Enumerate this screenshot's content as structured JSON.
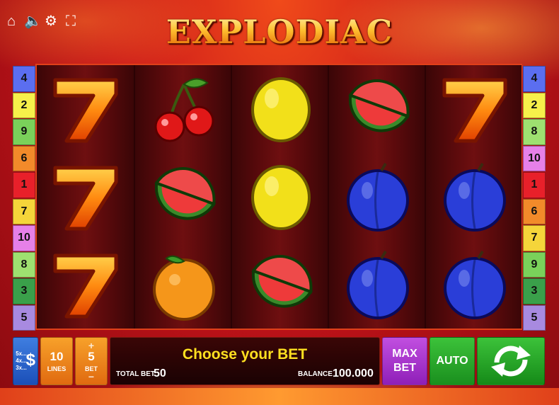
{
  "game": {
    "title": "EXPLODIAC"
  },
  "top_controls": [
    {
      "name": "home-icon",
      "glyph": "⌂"
    },
    {
      "name": "sound-icon",
      "glyph": "🔈"
    },
    {
      "name": "settings-icon",
      "glyph": "⚙"
    },
    {
      "name": "fullscreen-icon",
      "glyph": "⛶"
    }
  ],
  "reels": [
    [
      "seven",
      "seven",
      "seven"
    ],
    [
      "cherry",
      "watermelon",
      "orange"
    ],
    [
      "lemon",
      "lemon",
      "watermelon"
    ],
    [
      "watermelon",
      "plum",
      "plum"
    ],
    [
      "seven",
      "plum",
      "plum"
    ]
  ],
  "paylines_left": [
    {
      "n": "4",
      "color": "#5b6ef0"
    },
    {
      "n": "2",
      "color": "#f7f04a"
    },
    {
      "n": "9",
      "color": "#7ad15a"
    },
    {
      "n": "6",
      "color": "#f28a2a"
    },
    {
      "n": "1",
      "color": "#e8202a"
    },
    {
      "n": "7",
      "color": "#f5d53a"
    },
    {
      "n": "10",
      "color": "#e680e8"
    },
    {
      "n": "8",
      "color": "#9ee070"
    },
    {
      "n": "3",
      "color": "#3aa04a"
    },
    {
      "n": "5",
      "color": "#a88ae0"
    }
  ],
  "paylines_right": [
    {
      "n": "4",
      "color": "#5b6ef0"
    },
    {
      "n": "2",
      "color": "#f7f04a"
    },
    {
      "n": "8",
      "color": "#9ee070"
    },
    {
      "n": "10",
      "color": "#e680e8"
    },
    {
      "n": "1",
      "color": "#e8202a"
    },
    {
      "n": "6",
      "color": "#f28a2a"
    },
    {
      "n": "7",
      "color": "#f5d53a"
    },
    {
      "n": "9",
      "color": "#7ad15a"
    },
    {
      "n": "3",
      "color": "#3aa04a"
    },
    {
      "n": "5",
      "color": "#a88ae0"
    }
  ],
  "controls": {
    "paytable_rows": [
      "5x...",
      "4x...",
      "3x..."
    ],
    "paytable_symbol": "$",
    "lines_value": "10",
    "lines_label": "LINES",
    "bet_plus": "+",
    "bet_value": "5",
    "bet_label": "BET",
    "bet_minus": "−",
    "message": "Choose your BET",
    "total_bet_label": "TOTAL BET",
    "total_bet_value": "50",
    "balance_label": "BALANCE",
    "balance_value": "100.000",
    "maxbet_line1": "MAX",
    "maxbet_line2": "BET",
    "auto_label": "AUTO"
  }
}
